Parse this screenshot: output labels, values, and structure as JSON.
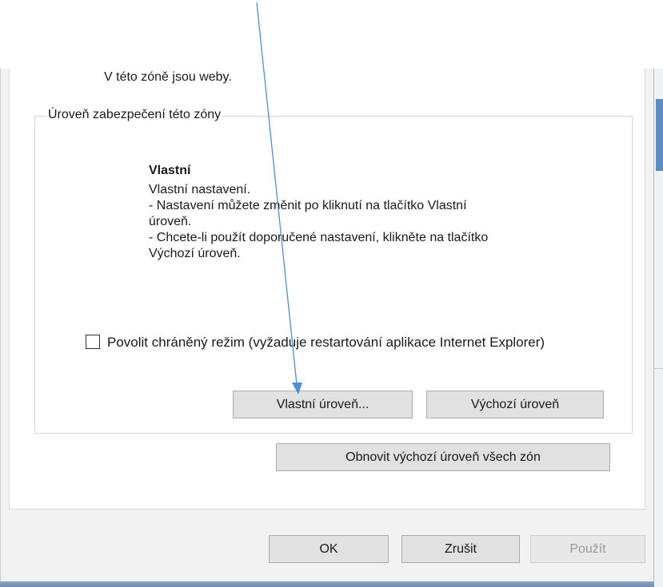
{
  "zone": {
    "description": "V této zóně jsou weby."
  },
  "security_level": {
    "group_title": "Úroveň zabezpečení této zóny",
    "level_name": "Vlastní",
    "description_lines": [
      "Vlastní nastavení.",
      "- Nastavení můžete změnit po kliknutí na tlačítko Vlastní",
      "úroveň.",
      "- Chcete-li použít doporučené nastavení, klikněte na tlačítko",
      "Výchozí úroveň."
    ]
  },
  "protected_mode": {
    "label": "Povolit chráněný režim (vyžaduje restartování aplikace Internet Explorer)",
    "checked": false
  },
  "buttons": {
    "custom_level": "Vlastní úroveň...",
    "default_level": "Výchozí úroveň",
    "reset_all": "Obnovit výchozí úroveň všech zón",
    "ok": "OK",
    "cancel": "Zrušit",
    "apply": "Použít"
  },
  "colors": {
    "annotation_arrow": "#4a90d9",
    "dialog_background": "#f2f2f2",
    "button_face": "#e1e1e1"
  }
}
